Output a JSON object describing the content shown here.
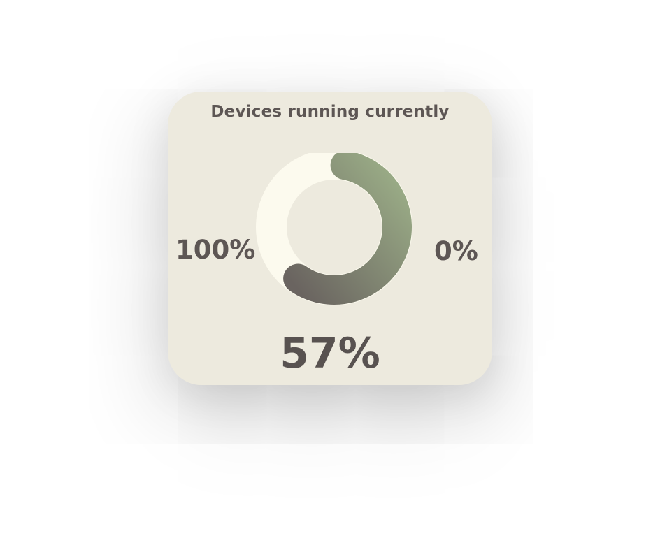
{
  "widget": {
    "title": "Devices running currently",
    "max_label": "100%",
    "min_label": "0%",
    "value_label": "57%",
    "value_fraction": 0.57
  },
  "colors": {
    "card_bg": "#edeade",
    "track": "#fcfaee",
    "arc_start": "#9caf88",
    "arc_end": "#6a6460",
    "text": "#5d5654"
  }
}
